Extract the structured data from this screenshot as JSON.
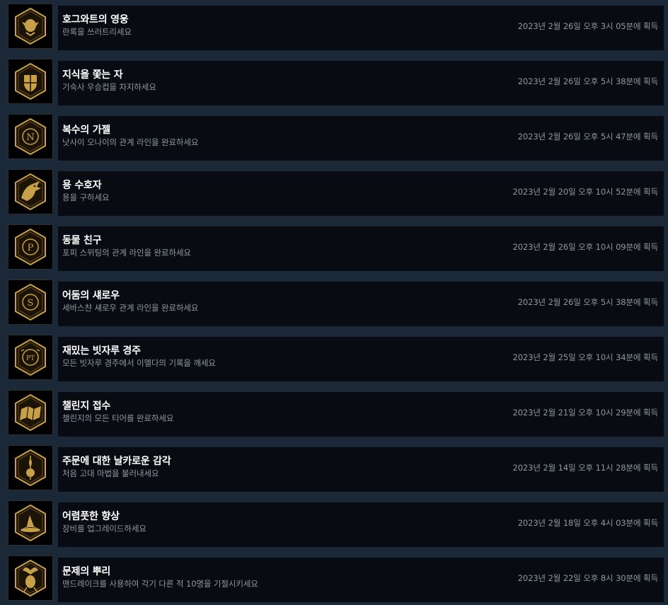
{
  "achievements": [
    {
      "title": "호그와트의 영웅",
      "description": "란록을 쓰러트리세요",
      "unlocked": "2023년 2월 26일 오후 3시 05분에 획득",
      "icon": "hero-icon"
    },
    {
      "title": "지식을 쫓는 자",
      "description": "기숙사 우승컵을 차지하세요",
      "unlocked": "2023년 2월 26일 오후 5시 38분에 획득",
      "icon": "hogwarts-crest-icon"
    },
    {
      "title": "복수의 가젤",
      "description": "낫사이 오나이의 관계 라인을 완료하세요",
      "unlocked": "2023년 2월 26일 오후 5시 47분에 획득",
      "icon": "letter-n-icon"
    },
    {
      "title": "용 수호자",
      "description": "용을 구하세요",
      "unlocked": "2023년 2월 20일 오후 10시 52분에 획득",
      "icon": "dragon-icon"
    },
    {
      "title": "동물 친구",
      "description": "포피 스위팅의 관계 라인을 완료하세요",
      "unlocked": "2023년 2월 26일 오후 10시 09분에 획득",
      "icon": "letter-p-icon"
    },
    {
      "title": "어둠의 섀로우",
      "description": "세바스챤 섀로우 관계 라인을 완료하세요",
      "unlocked": "2023년 2월 26일 오후 5시 38분에 획득",
      "icon": "letter-s-icon"
    },
    {
      "title": "재밌는 빗자루 경주",
      "description": "모든 빗자루 경주에서 이멜다의 기록을 깨세요",
      "unlocked": "2023년 2월 25일 오후 10시 34분에 획득",
      "icon": "broom-race-icon"
    },
    {
      "title": "챌린지 접수",
      "description": "챌린지의 모든 티어를 완료하세요",
      "unlocked": "2023년 2월 21일 오후 10시 29분에 획득",
      "icon": "map-icon"
    },
    {
      "title": "주문에 대한 날카로운 감각",
      "description": "처음 고대 마법을 불러내세요",
      "unlocked": "2023년 2월 14일 오후 11시 28분에 획득",
      "icon": "ancient-magic-icon"
    },
    {
      "title": "어렴풋한 향상",
      "description": "장비를 업그레이드하세요",
      "unlocked": "2023년 2월 18일 오후 4시 03분에 획득",
      "icon": "wizard-hat-icon"
    },
    {
      "title": "문제의 뿌리",
      "description": "맨드레이크를 사용하여 각기 다른 적 10명을 기절시키세요",
      "unlocked": "2023년 2월 22일 오후 8시 30분에 획득",
      "icon": "mandrake-icon"
    }
  ],
  "colors": {
    "page_background": "#1b2838",
    "row_background": "#080c12",
    "icon_background": "#000000",
    "gold": "#c9a04a",
    "gold_dark": "#6b4e1c",
    "title_text": "#ffffff",
    "secondary_text": "#8f98a0"
  }
}
